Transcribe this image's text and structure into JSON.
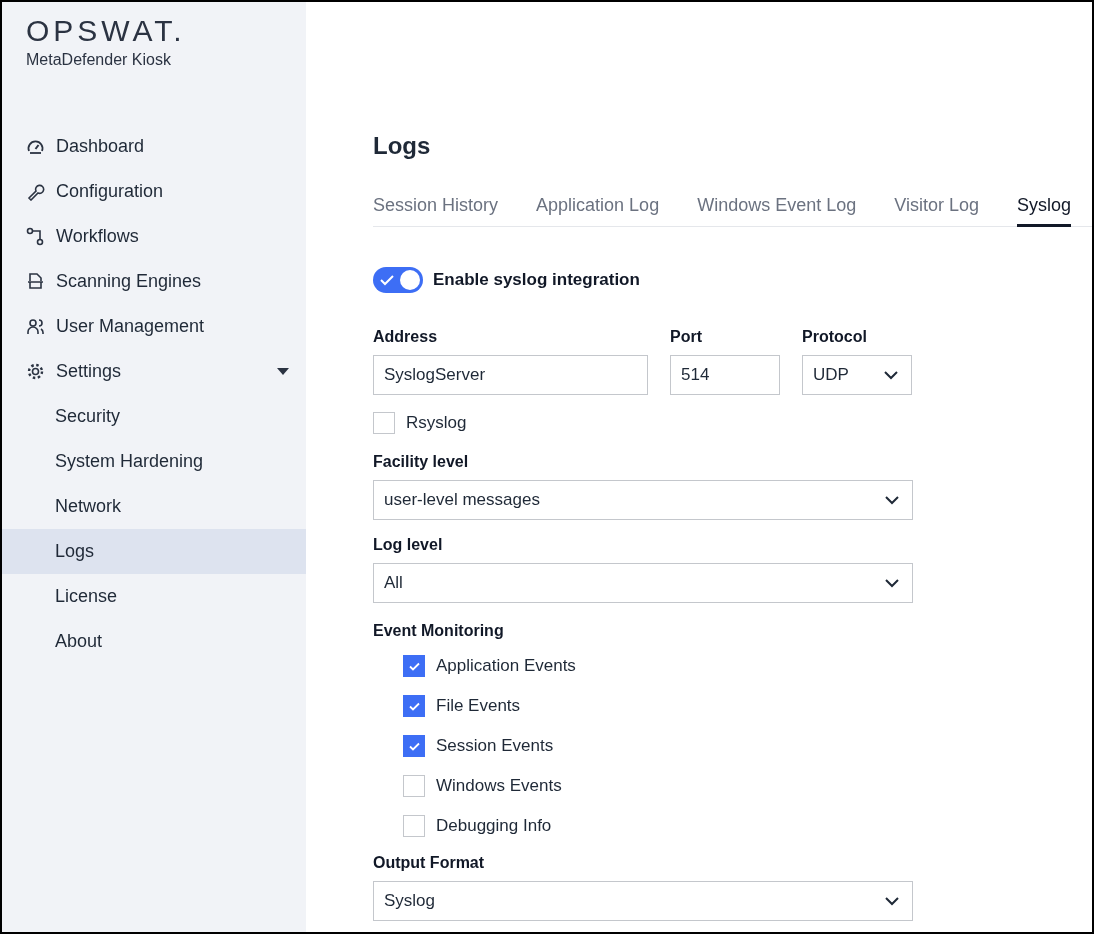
{
  "brand": {
    "logo": "OPSWAT.",
    "product": "MetaDefender Kiosk"
  },
  "sidebar": {
    "items": [
      {
        "label": "Dashboard",
        "selected": false
      },
      {
        "label": "Configuration",
        "selected": false
      },
      {
        "label": "Workflows",
        "selected": false
      },
      {
        "label": "Scanning Engines",
        "selected": false
      },
      {
        "label": "User Management",
        "selected": false
      },
      {
        "label": "Settings",
        "selected": false,
        "expanded": true,
        "children": [
          {
            "label": "Security",
            "selected": false
          },
          {
            "label": "System Hardening",
            "selected": false
          },
          {
            "label": "Network",
            "selected": false
          },
          {
            "label": "Logs",
            "selected": true
          },
          {
            "label": "License",
            "selected": false
          },
          {
            "label": "About",
            "selected": false
          }
        ]
      }
    ]
  },
  "page": {
    "title": "Logs"
  },
  "tabs": [
    {
      "label": "Session History",
      "selected": false
    },
    {
      "label": "Application Log",
      "selected": false
    },
    {
      "label": "Windows Event Log",
      "selected": false
    },
    {
      "label": "Visitor Log",
      "selected": false
    },
    {
      "label": "Syslog",
      "selected": true
    }
  ],
  "syslog_toggle": {
    "label": "Enable syslog integration",
    "on": true
  },
  "connection": [
    {
      "label": "Address",
      "kind": "text",
      "value": "SyslogServer"
    },
    {
      "label": "Port",
      "kind": "text",
      "value": "514"
    },
    {
      "label": "Protocol",
      "kind": "select",
      "value": "UDP"
    }
  ],
  "rsyslog": {
    "label": "Rsyslog",
    "checked": false
  },
  "facility_level": {
    "label": "Facility level",
    "value": "user-level messages"
  },
  "log_level": {
    "label": "Log level",
    "value": "All"
  },
  "event_monitoring": {
    "label": "Event Monitoring",
    "items": [
      {
        "label": "Application Events",
        "checked": true
      },
      {
        "label": "File Events",
        "checked": true
      },
      {
        "label": "Session Events",
        "checked": true
      },
      {
        "label": "Windows Events",
        "checked": false
      },
      {
        "label": "Debugging Info",
        "checked": false
      }
    ]
  },
  "output_format": {
    "label": "Output Format",
    "value": "Syslog"
  }
}
